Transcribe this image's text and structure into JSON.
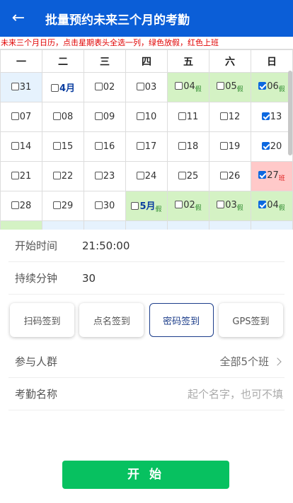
{
  "header": {
    "back_icon": "arrow-left-icon",
    "title": "批量预约未来三个月的考勤"
  },
  "hint": "未来三个月日历，点击星期表头全选一列，绿色放假，红色上班",
  "calendar": {
    "weekdays": [
      "一",
      "二",
      "三",
      "四",
      "五",
      "六",
      "日"
    ],
    "rows": [
      [
        {
          "label": "31",
          "checked": false,
          "bg": "blue",
          "month": false,
          "sub": ""
        },
        {
          "label": "4月",
          "checked": false,
          "bg": "",
          "month": true,
          "sub": ""
        },
        {
          "label": "02",
          "checked": false,
          "bg": "",
          "month": false,
          "sub": ""
        },
        {
          "label": "03",
          "checked": false,
          "bg": "",
          "month": false,
          "sub": ""
        },
        {
          "label": "04",
          "checked": false,
          "bg": "green",
          "month": false,
          "sub": "假"
        },
        {
          "label": "05",
          "checked": false,
          "bg": "green",
          "month": false,
          "sub": "假"
        },
        {
          "label": "06",
          "checked": true,
          "bg": "green",
          "month": false,
          "sub": "假"
        }
      ],
      [
        {
          "label": "07",
          "checked": false,
          "bg": "",
          "month": false,
          "sub": ""
        },
        {
          "label": "08",
          "checked": false,
          "bg": "",
          "month": false,
          "sub": ""
        },
        {
          "label": "09",
          "checked": false,
          "bg": "",
          "month": false,
          "sub": ""
        },
        {
          "label": "10",
          "checked": false,
          "bg": "",
          "month": false,
          "sub": ""
        },
        {
          "label": "11",
          "checked": false,
          "bg": "",
          "month": false,
          "sub": ""
        },
        {
          "label": "12",
          "checked": false,
          "bg": "",
          "month": false,
          "sub": ""
        },
        {
          "label": "13",
          "checked": true,
          "bg": "",
          "month": false,
          "sub": ""
        }
      ],
      [
        {
          "label": "14",
          "checked": false,
          "bg": "",
          "month": false,
          "sub": ""
        },
        {
          "label": "15",
          "checked": false,
          "bg": "",
          "month": false,
          "sub": ""
        },
        {
          "label": "16",
          "checked": false,
          "bg": "",
          "month": false,
          "sub": ""
        },
        {
          "label": "17",
          "checked": false,
          "bg": "",
          "month": false,
          "sub": ""
        },
        {
          "label": "18",
          "checked": false,
          "bg": "",
          "month": false,
          "sub": ""
        },
        {
          "label": "19",
          "checked": false,
          "bg": "",
          "month": false,
          "sub": ""
        },
        {
          "label": "20",
          "checked": true,
          "bg": "",
          "month": false,
          "sub": ""
        }
      ],
      [
        {
          "label": "21",
          "checked": false,
          "bg": "",
          "month": false,
          "sub": ""
        },
        {
          "label": "22",
          "checked": false,
          "bg": "",
          "month": false,
          "sub": ""
        },
        {
          "label": "23",
          "checked": false,
          "bg": "",
          "month": false,
          "sub": ""
        },
        {
          "label": "24",
          "checked": false,
          "bg": "",
          "month": false,
          "sub": ""
        },
        {
          "label": "25",
          "checked": false,
          "bg": "",
          "month": false,
          "sub": ""
        },
        {
          "label": "26",
          "checked": false,
          "bg": "",
          "month": false,
          "sub": ""
        },
        {
          "label": "27",
          "checked": true,
          "bg": "red",
          "month": false,
          "sub": "班"
        }
      ],
      [
        {
          "label": "28",
          "checked": false,
          "bg": "",
          "month": false,
          "sub": ""
        },
        {
          "label": "29",
          "checked": false,
          "bg": "",
          "month": false,
          "sub": ""
        },
        {
          "label": "30",
          "checked": false,
          "bg": "",
          "month": false,
          "sub": ""
        },
        {
          "label": "5月",
          "checked": false,
          "bg": "green",
          "month": true,
          "sub": "假"
        },
        {
          "label": "02",
          "checked": false,
          "bg": "green",
          "month": false,
          "sub": "假"
        },
        {
          "label": "03",
          "checked": false,
          "bg": "green",
          "month": false,
          "sub": "假"
        },
        {
          "label": "04",
          "checked": true,
          "bg": "green",
          "month": false,
          "sub": "假"
        }
      ],
      [
        {
          "label": "",
          "checked": false,
          "bg": "green",
          "month": false,
          "sub": ""
        },
        {
          "label": "",
          "checked": false,
          "bg": "blue",
          "month": false,
          "sub": ""
        },
        {
          "label": "",
          "checked": false,
          "bg": "blue",
          "month": false,
          "sub": ""
        },
        {
          "label": "",
          "checked": false,
          "bg": "blue",
          "month": false,
          "sub": ""
        },
        {
          "label": "",
          "checked": false,
          "bg": "blue",
          "month": false,
          "sub": ""
        },
        {
          "label": "",
          "checked": false,
          "bg": "blue",
          "month": false,
          "sub": ""
        },
        {
          "label": "",
          "checked": true,
          "bg": "blue",
          "month": false,
          "sub": ""
        }
      ]
    ]
  },
  "form": {
    "start_time": {
      "label": "开始时间",
      "value": "21:50:00"
    },
    "duration": {
      "label": "持续分钟",
      "value": "30"
    },
    "methods": [
      "扫码签到",
      "点名签到",
      "密码签到",
      "GPS签到"
    ],
    "active_method": 2,
    "group": {
      "label": "参与人群",
      "value": "全部5个班"
    },
    "name": {
      "label": "考勤名称",
      "placeholder": "起个名字，也可不填"
    }
  },
  "start_button": "开 始",
  "colors": {
    "header": "#0b5ed7",
    "start": "#07c160",
    "green_cell": "#d4f2c4",
    "red_cell": "#ffc9c9",
    "blue_cell": "#e6f2fd"
  }
}
